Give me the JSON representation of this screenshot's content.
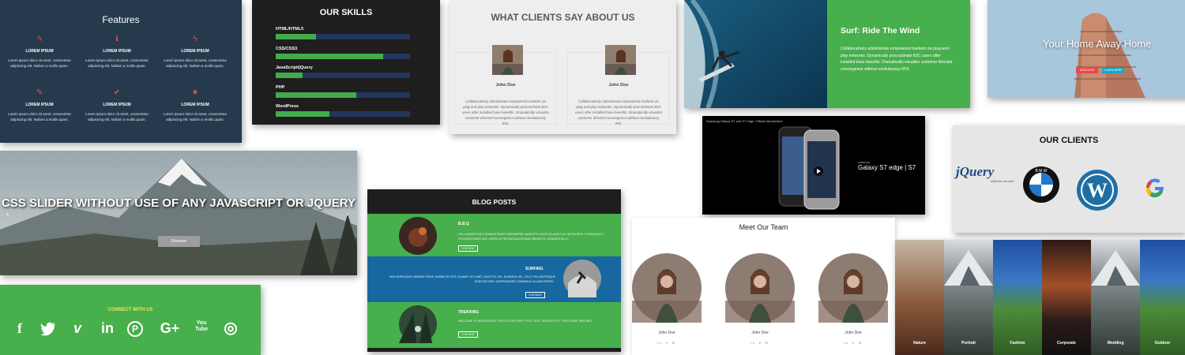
{
  "features": {
    "title": "Features",
    "items": [
      {
        "icon": "bolt-icon",
        "glyph": "ϟ",
        "heading": "LOREM IPSUM",
        "text": "Lorem ipsum dolor sit amet, consectetur adipiscing elit. Nullam a mollis quam."
      },
      {
        "icon": "info-icon",
        "glyph": "ℹ",
        "heading": "LOREM IPSUM",
        "text": "Lorem ipsum dolor sit amet, consectetur adipiscing elit. Nullam a mollis quam."
      },
      {
        "icon": "bolt-icon",
        "glyph": "ϟ",
        "heading": "LOREM IPSUM",
        "text": "Lorem ipsum dolor sit amet, consectetur adipiscing elit. Nullam a mollis quam."
      },
      {
        "icon": "edit-icon",
        "glyph": "✎",
        "heading": "LOREM IPSUM",
        "text": "Lorem ipsum dolor sit amet, consectetur adipiscing elit. Nullam a mollis quam."
      },
      {
        "icon": "check-icon",
        "glyph": "✔",
        "heading": "LOREM IPSUM",
        "text": "Lorem ipsum dolor sit amet, consectetur adipiscing elit. Nullam a mollis quam."
      },
      {
        "icon": "star-icon",
        "glyph": "★",
        "heading": "LOREM IPSUM",
        "text": "Lorem ipsum dolor sit amet, consectetur adipiscing elit. Nullam a mollis quam."
      }
    ]
  },
  "skills": {
    "title": "OUR SKILLS",
    "items": [
      {
        "name": "HTML/HTML5",
        "level": 0.3
      },
      {
        "name": "CSS/CSS3",
        "level": 0.8
      },
      {
        "name": "JavaScript/jQuery",
        "level": 0.2
      },
      {
        "name": "PHP",
        "level": 0.6
      },
      {
        "name": "WordPress",
        "level": 0.4
      }
    ]
  },
  "clients_say": {
    "title": "WHAT CLIENTS SAY ABOUT US",
    "items": [
      {
        "name": "John Doe",
        "text": "Collaboratively administrate empowered markets via plug-and-play networks. Dynamically procrastinate B2C users after installed base benefits. Dramatically visualize customer directed convergence without revolutionary ROI."
      },
      {
        "name": "John Doe",
        "text": "Collaboratively administrate empowered markets via plug-and-play networks. Dynamically procrastinate B2C users after installed base benefits. Dramatically visualize customer directed convergence without revolutionary ROI."
      }
    ]
  },
  "surf": {
    "heading": "Surf: Ride The Wind",
    "text": "Collaboratively administrate empowered markets via plug-and-play networks. Dynamically procrastinate B2C users after installed base benefits. Dramatically visualize customer directed convergence without revolutionary ROI."
  },
  "home": {
    "heading": "Your Home Away Home",
    "button_1": "DISCOVER",
    "button_2": "LEARN MORE"
  },
  "slider": {
    "heading": "CSS SLIDER WITHOUT USE OF ANY JAVASCRIPT OR JQUERY",
    "button": "Discover",
    "prev": "‹",
    "next": "›"
  },
  "blog": {
    "title": "BLOG POSTS",
    "posts": [
      {
        "heading": "B.B.Q",
        "text": "COLLABORATIVELY ADMINISTRATE EMPOWERED MARKETS VIA PLUG-AND-PLAY NETWORKS. DYNAMICALLY PROCRASTINATE B2C USERS AFTER INSTALLED BASE BENEFITS. DRAMATICALLY...",
        "button": "CONTINUE",
        "bg": "#47af4c"
      },
      {
        "heading": "SURFING",
        "text": "SED ADIPISCING ORNARE RISUS. MORBI EST EST, BLANDIT SIT AMET, SAGITTIS VEL, EUISMOD VEL, VELIT. PELLENTESQUE EGESTAS SEM. SUSPENDISSE COMMODO ULLAMCORPER...",
        "button": "CONTINUE",
        "bg": "#17689f"
      },
      {
        "heading": "TREKKING",
        "text": "WELCOME TO WORDPRESS. THIS IS YOUR FIRST POST. EDIT OR DELETE IT, THEN START WRITING!",
        "button": "CONTINUE",
        "bg": "#47af4c"
      }
    ]
  },
  "video": {
    "title": "Samsung Galaxy S7 and S7 edge: Official Introduction",
    "brand": "SAMSUNG",
    "caption": "Galaxy S7 edge | S7"
  },
  "our_clients": {
    "title": "OUR CLIENTS",
    "logos": [
      {
        "icon": "jquery-logo-icon",
        "text": "jQuery",
        "tagline": "write less, do more."
      },
      {
        "icon": "bmw-logo-icon",
        "text": "B M W"
      },
      {
        "icon": "wordpress-logo-icon",
        "text": "W"
      },
      {
        "icon": "google-logo-icon",
        "text": "G"
      }
    ]
  },
  "connect": {
    "title": "CONNECT WITH US",
    "icons": [
      {
        "icon": "facebook-icon",
        "glyph": "f"
      },
      {
        "icon": "twitter-icon",
        "glyph": "🐦"
      },
      {
        "icon": "vimeo-icon",
        "glyph": "v"
      },
      {
        "icon": "linkedin-icon",
        "glyph": "in"
      },
      {
        "icon": "pinterest-icon",
        "glyph": "P"
      },
      {
        "icon": "google-plus-icon",
        "glyph": "G+"
      },
      {
        "icon": "youtube-icon",
        "glyph": "You\nTube"
      },
      {
        "icon": "instagram-icon",
        "glyph": "◎"
      }
    ]
  },
  "team": {
    "title": "Meet Our Team",
    "members": [
      {
        "name": "John Doe",
        "social": "in ✦ ✉"
      },
      {
        "name": "John Doe",
        "social": "in ✦ ✉"
      },
      {
        "name": "John Doe",
        "social": "in ✦ ✉"
      }
    ]
  },
  "gallery": {
    "panels": [
      {
        "label": "Nature"
      },
      {
        "label": "Portrait"
      },
      {
        "label": "Fashion"
      },
      {
        "label": "Corporate"
      },
      {
        "label": "Wedding"
      },
      {
        "label": "Outdoor"
      }
    ]
  },
  "colors": {
    "green": "#47af4c",
    "navy": "#263a4e",
    "dark": "#1e1e1e",
    "blue": "#17689f",
    "red_accent": "#e7504f"
  }
}
